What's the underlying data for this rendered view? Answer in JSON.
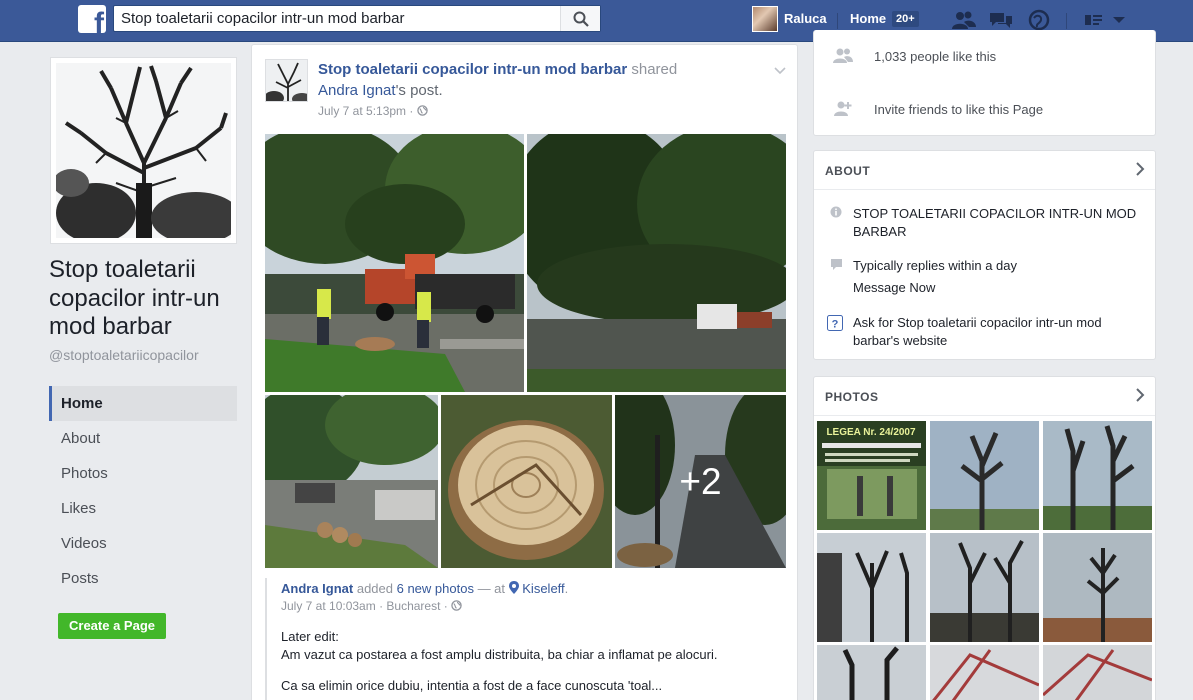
{
  "topbar": {
    "logo": "f",
    "search_value": "Stop toaletarii copacilor intr-un mod barbar",
    "user_name": "Raluca",
    "home_label": "Home",
    "home_badge": "20+",
    "icons": [
      "friend-requests-icon",
      "messages-icon",
      "notifications-icon",
      "quick-help-icon",
      "account-menu-icon"
    ]
  },
  "left": {
    "page_name": "Stop toaletarii copacilor intr-un mod barbar",
    "handle": "@stoptoaletariicopacilor",
    "nav": [
      "Home",
      "About",
      "Photos",
      "Likes",
      "Videos",
      "Posts"
    ],
    "active_nav": "Home",
    "create_page": "Create a Page"
  },
  "post": {
    "author": "Stop toaletarii copacilor intr-un mod barbar",
    "shared_word": "shared",
    "shared_from_name": "Andra Ignat",
    "shared_from_suffix": "'s post.",
    "time": "July 7 at 5:13pm",
    "time_sep": "·",
    "more_photos": "+2",
    "shared": {
      "author": "Andra Ignat",
      "added": " added ",
      "count_text": "6 new photos",
      "dash_at": " — at ",
      "place": "Kiseleff",
      "place_end": ".",
      "time": "July 7 at 10:03am",
      "time_sep1": " · ",
      "location": "Bucharest",
      "time_sep2": " · ",
      "text_line1": "Later edit:",
      "text_line2": "Am vazut ca postarea a fost amplu distribuita, ba chiar a inflamat pe alocuri.",
      "text_line3": "Ca sa elimin orice dubiu, intentia a fost de a face cunoscuta 'toal..."
    }
  },
  "right": {
    "likes_count": "1,033 people like this",
    "invite": "Invite friends to like this Page",
    "about_title": "ABOUT",
    "about_desc": "STOP TOALETARII COPACILOR INTR-UN MOD BARBAR",
    "replies": "Typically replies within a day",
    "message_now": "Message Now",
    "ask_website": "Ask for Stop toaletarii copacilor intr-un mod barbar's website",
    "photos_title": "PHOTOS",
    "thumb1_text": "LEGEA Nr. 24/2007"
  },
  "colors": {
    "brand": "#3b5998",
    "link": "#365899",
    "green": "#42b72a",
    "background": "#e9ebee"
  }
}
